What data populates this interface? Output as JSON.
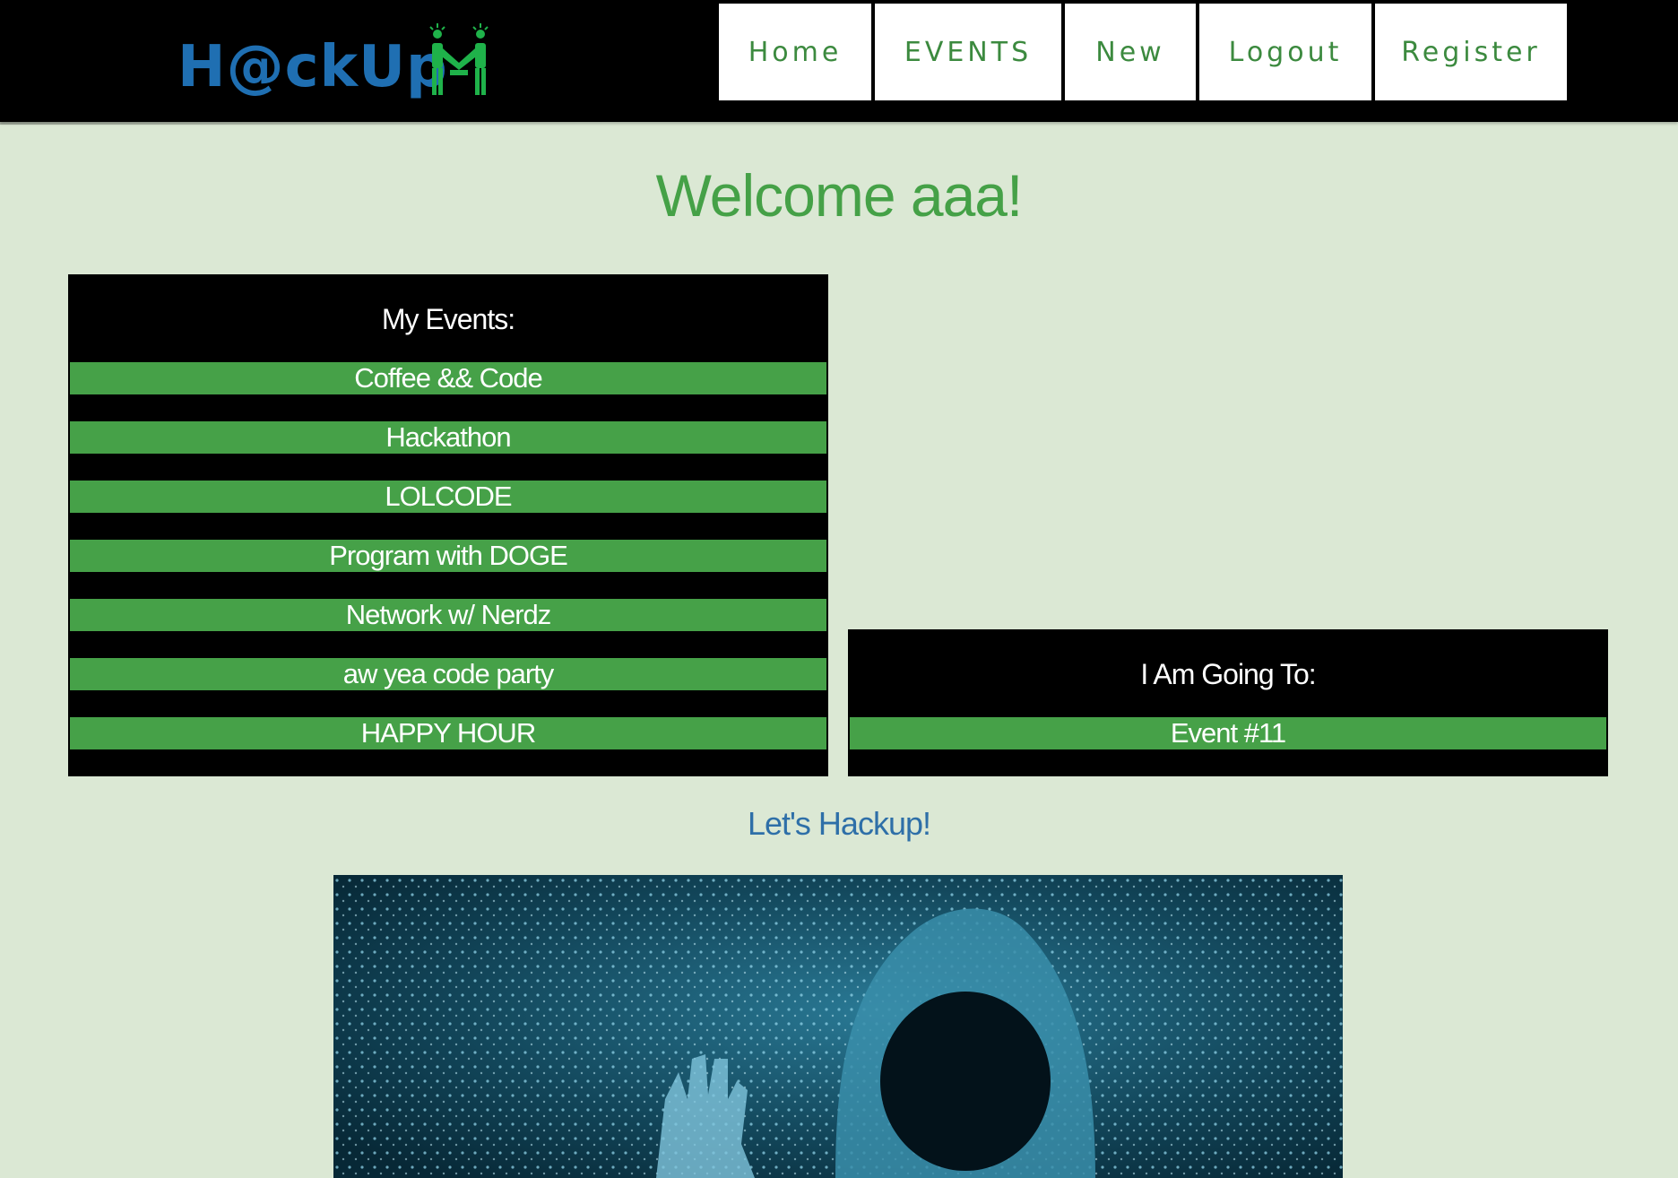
{
  "header": {
    "logo_text": "H@ckUp"
  },
  "nav": {
    "items": [
      {
        "label": "Home"
      },
      {
        "label": "EVENTS"
      },
      {
        "label": "New"
      },
      {
        "label": "Logout"
      },
      {
        "label": "Register"
      }
    ]
  },
  "main": {
    "welcome": "Welcome aaa!",
    "my_events": {
      "title": "My Events:",
      "items": [
        "Coffee && Code",
        "Hackathon",
        "LOLCODE",
        "Program with DOGE",
        "Network w/ Nerdz",
        "aw yea code party",
        "HAPPY HOUR"
      ]
    },
    "going_to": {
      "title": "I Am Going To:",
      "items": [
        "Event #11"
      ]
    },
    "tagline": "Let's Hackup!"
  },
  "colors": {
    "background": "#dbe8d4",
    "header": "#000000",
    "accent_green": "#46a148",
    "nav_text": "#3c8a3f",
    "tagline_blue": "#2e6fa8",
    "logo_blue": "#1f6fb2"
  }
}
